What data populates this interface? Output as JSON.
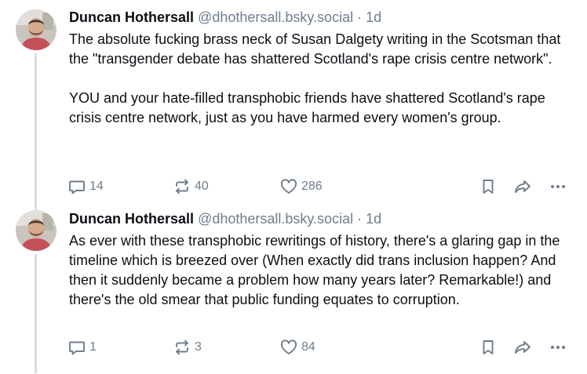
{
  "posts": [
    {
      "author_name": "Duncan Hothersall",
      "handle": "@dhothersall.bsky.social",
      "separator": "·",
      "time": "1d",
      "paragraphs": [
        "The absolute fucking brass neck of Susan Dalgety writing in the Scotsman that the \"transgender debate has shattered Scotland's rape crisis centre network\".",
        "YOU and your hate-filled transphobic friends have shattered Scotland's rape crisis centre network, just as you have harmed every women's group."
      ],
      "reply_count": "14",
      "repost_count": "40",
      "like_count": "286"
    },
    {
      "author_name": "Duncan Hothersall",
      "handle": "@dhothersall.bsky.social",
      "separator": "·",
      "time": "1d",
      "paragraphs": [
        "As ever with these transphobic rewritings of history, there's a glaring gap in the timeline which is breezed over (When exactly did trans inclusion happen? And then it suddenly became a problem how many years later? Remarkable!) and there's the old smear that public funding equates to corruption."
      ],
      "reply_count": "1",
      "repost_count": "3",
      "like_count": "84"
    }
  ],
  "icons": {
    "reply": "reply-icon",
    "repost": "repost-icon",
    "like": "heart-icon",
    "bookmark": "bookmark-icon",
    "share": "share-icon",
    "more": "more-icon"
  },
  "colors": {
    "text": "#0b0f14",
    "muted": "#6f7d8c",
    "thread_line": "#d4dbe2"
  }
}
